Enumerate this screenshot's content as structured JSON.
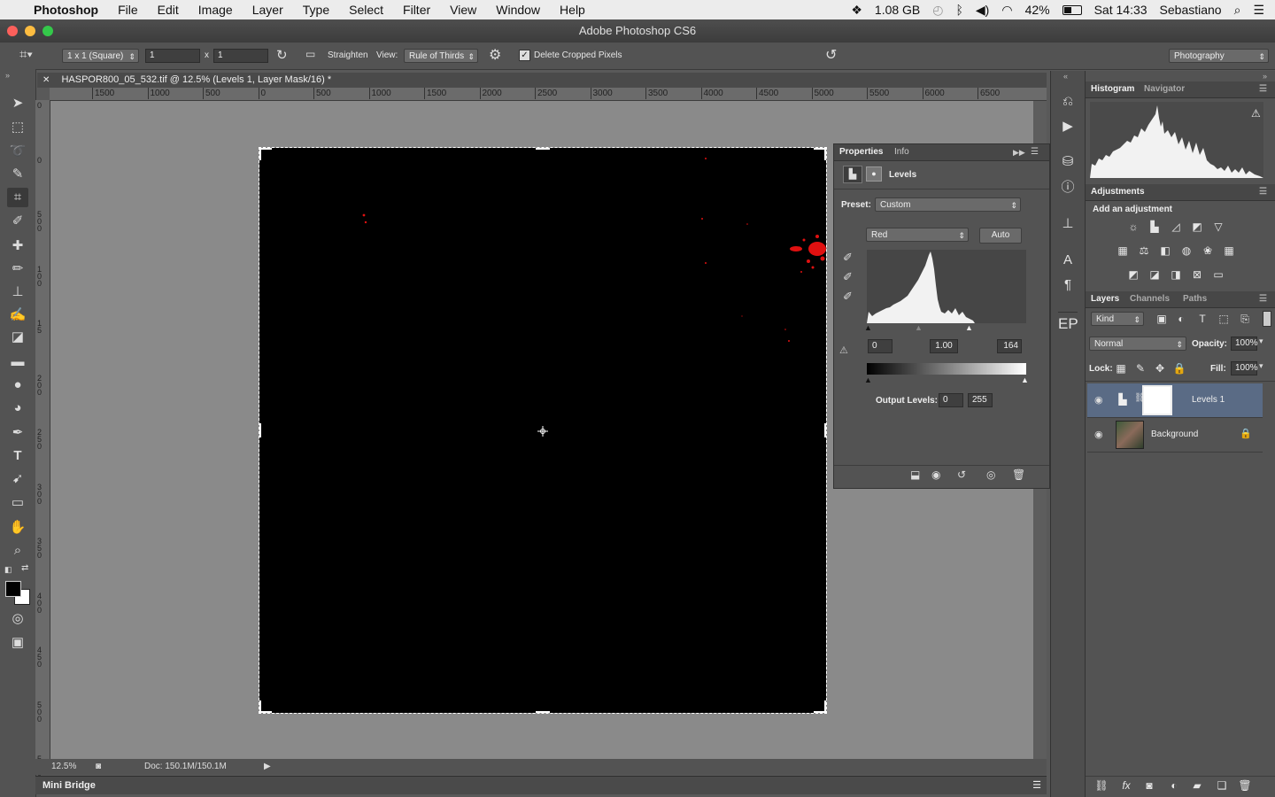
{
  "menubar": {
    "app_name": "Photoshop",
    "items": [
      "File",
      "Edit",
      "Image",
      "Layer",
      "Type",
      "Select",
      "Filter",
      "View",
      "Window",
      "Help"
    ],
    "status": {
      "memory": "1.08 GB",
      "battery": "42%",
      "clock": "Sat 14:33",
      "user": "Sebastiano"
    }
  },
  "window": {
    "title": "Adobe Photoshop CS6"
  },
  "options_bar": {
    "ratio": "1 x 1 (Square)",
    "width_value": "1",
    "times": "x",
    "height_value": "1",
    "straighten": "Straighten",
    "view_label": "View:",
    "view_value": "Rule of Thirds",
    "delete_cropped": "Delete Cropped Pixels",
    "workspace": "Photography"
  },
  "document": {
    "tab_title": "HASPOR800_05_532.tif @ 12.5% (Levels 1, Layer Mask/16) *",
    "ruler_h": [
      "1500",
      "1000",
      "500",
      "0",
      "500",
      "1000",
      "1500",
      "2000",
      "2500",
      "3000",
      "3500",
      "4000",
      "4500",
      "5000",
      "5500",
      "6000",
      "6500"
    ],
    "ruler_v": [
      "0",
      "0",
      "5 0 0",
      "1 0 0",
      "1 5",
      "2 0 0",
      "2 5 0",
      "3 0 0",
      "3 5 0",
      "4 0 0",
      "4 5 0",
      "5 0 0",
      "5 5 0"
    ],
    "zoom": "12.5%",
    "doc_size": "Doc: 150.1M/150.1M"
  },
  "mini_bridge": {
    "label": "Mini Bridge"
  },
  "properties": {
    "tabs": [
      "Properties",
      "Info"
    ],
    "adjustment_name": "Levels",
    "preset_label": "Preset:",
    "preset_value": "Custom",
    "channel": "Red",
    "auto": "Auto",
    "input_black": "0",
    "input_gamma": "1.00",
    "input_white": "164",
    "output_label": "Output Levels:",
    "output_black": "0",
    "output_white": "255"
  },
  "histogram_panel": {
    "tabs": [
      "Histogram",
      "Navigator"
    ]
  },
  "adjustments_panel": {
    "title": "Adjustments",
    "subtitle": "Add an adjustment"
  },
  "layers_panel": {
    "tabs": [
      "Layers",
      "Channels",
      "Paths"
    ],
    "filter_kind": "Kind",
    "blend_mode": "Normal",
    "opacity_label": "Opacity:",
    "opacity_value": "100%",
    "lock_label": "Lock:",
    "fill_label": "Fill:",
    "fill_value": "100%",
    "layers": [
      {
        "name": "Levels 1"
      },
      {
        "name": "Background"
      }
    ]
  },
  "strip": {
    "ep_label": "EP"
  },
  "colors": {
    "accent_selected": "#5a6b85",
    "panel": "#535353",
    "canvas": "#000000"
  }
}
